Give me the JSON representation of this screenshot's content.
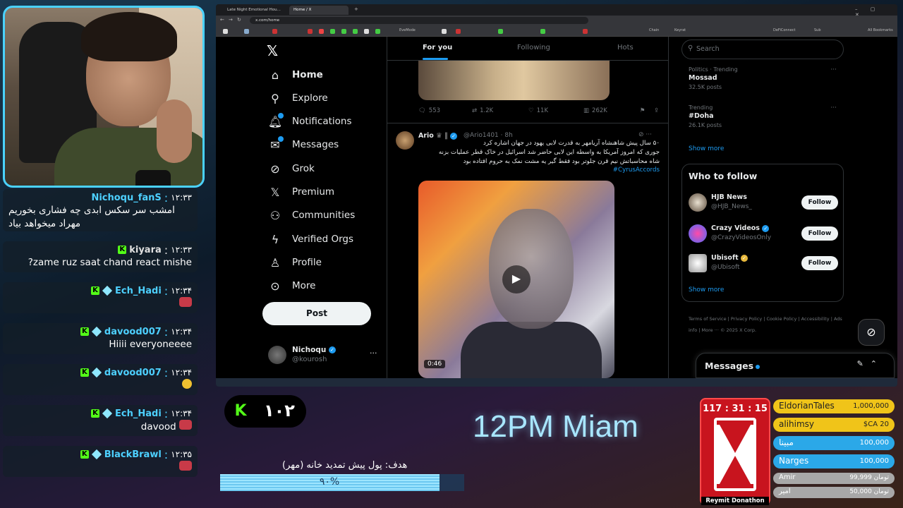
{
  "webcam": {
    "label": "streamer-webcam"
  },
  "chat": {
    "messages": [
      {
        "time": "۱۲:۳۳",
        "user": "Nichoqu_fanS",
        "user_color": "#4dd0ff",
        "text": "امشب سر سکس ابدی چه فشاری بخوریم مهراد میخواهد بیاد"
      },
      {
        "time": "۱۲:۳۳",
        "user": "kiyara",
        "user_color": "#e0e0e0",
        "text": "?zame ruz saat chand react mishe"
      },
      {
        "time": "۱۲:۳۴",
        "user": "Ech_Hadi",
        "user_color": "#4dd0ff",
        "text": ""
      },
      {
        "time": "۱۲:۳۴",
        "user": "davood007",
        "user_color": "#4dd0ff",
        "text": "Hiiii everyoneeee"
      },
      {
        "time": "۱۲:۳۴",
        "user": "davood007",
        "user_color": "#4dd0ff",
        "text": ""
      },
      {
        "time": "۱۲:۳۴",
        "user": "Ech_Hadi",
        "user_color": "#4dd0ff",
        "text": "davood"
      },
      {
        "time": "۱۲:۳۵",
        "user": "BlackBrawl",
        "user_color": "#4dd0ff",
        "text": ""
      }
    ]
  },
  "browser": {
    "tabs": [
      "Late Night Emotional Hou...",
      "Home / X"
    ],
    "url": "x.com/home",
    "bookmark_labels": [
      "EveMode",
      "Chain",
      "Keyrat",
      "DeFiConnect",
      "Sub",
      "All Bookmarks"
    ]
  },
  "x": {
    "nav": [
      {
        "label": "Home",
        "icon": "home-icon"
      },
      {
        "label": "Explore",
        "icon": "search-icon"
      },
      {
        "label": "Notifications",
        "icon": "bell-icon"
      },
      {
        "label": "Messages",
        "icon": "envelope-icon"
      },
      {
        "label": "Grok",
        "icon": "grok-icon"
      },
      {
        "label": "Premium",
        "icon": "x-icon"
      },
      {
        "label": "Communities",
        "icon": "people-icon"
      },
      {
        "label": "Verified Orgs",
        "icon": "lightning-icon"
      },
      {
        "label": "Profile",
        "icon": "person-icon"
      },
      {
        "label": "More",
        "icon": "more-circle-icon"
      }
    ],
    "post_label": "Post",
    "profile": {
      "name": "Nichoqu",
      "handle": "@kourosh"
    },
    "feed_tabs": [
      "For you",
      "Following",
      "Hots"
    ],
    "prev_actions": {
      "replies": "553",
      "reposts": "1.2K",
      "likes": "11K",
      "views": "262K"
    },
    "tweet": {
      "name": "Ario",
      "handle": "@Ario1401 · 8h",
      "lines": [
        "۵۰ سال پیش شاهنشاه آریامهر به قدرت لابی یهود در جهان اشاره کرد",
        "جوری که امروز آمریکا به واسطه این لابی حاضر شد اسرائیل در خاک قطر عملیات بزنه",
        "شاه محاسباتش نیم قرن جلوتر بود فقط گیر یه مشت نمک به حروم افتاده بود"
      ],
      "hashtag": "#CyrusAccords",
      "duration": "0:46"
    },
    "search_placeholder": "Search",
    "trends": [
      {
        "category": "Politics · Trending",
        "name": "Mossad",
        "count": "32.5K posts"
      },
      {
        "category": "Trending",
        "name": "#Doha",
        "count": "26.1K posts"
      }
    ],
    "show_more": "Show more",
    "who_to_follow": {
      "title": "Who to follow",
      "accounts": [
        {
          "name": "HJB News",
          "handle": "@HJB_News_",
          "verified": "none"
        },
        {
          "name": "Crazy Videos",
          "handle": "@CrazyVideosOnly",
          "verified": "blue"
        },
        {
          "name": "Ubisoft",
          "handle": "@Ubisoft",
          "verified": "gold"
        }
      ],
      "follow_label": "Follow",
      "show_more": "Show more"
    },
    "footer": "Terms of Service  |  Privacy Policy  |  Cookie Policy  |  Accessibility  |  Ads info  |  More ···  © 2025 X Corp.",
    "messages_drawer": "Messages"
  },
  "overlay": {
    "kick_count": "۱۰۲",
    "stream_title": "12PM Miam",
    "goal_label": "هدف: پول پیش تمدید خانه (مهر)",
    "goal_percent_text": "۹۰%",
    "goal_progress": 0.9,
    "timer": "117 : 31 : 15",
    "donation_label": "Reymit Donathon",
    "leaderboard": [
      {
        "name": "EldorianTales",
        "amount": "1,000,000",
        "color": "#f0c419",
        "style": "dark"
      },
      {
        "name": "alihimsy",
        "amount": "$CA 20",
        "color": "#f0c419",
        "style": "dark"
      },
      {
        "name": "مبینا",
        "amount": "100,000",
        "color": "#2ba8e8",
        "style": "light"
      },
      {
        "name": "Narges",
        "amount": "100,000",
        "color": "#2ba8e8",
        "style": "light"
      },
      {
        "name": "Amir",
        "amount": "99,999 تومان",
        "color": "#a8a8a8",
        "style": "small"
      },
      {
        "name": "امیر",
        "amount": "50,000 تومان",
        "color": "#a8a8a8",
        "style": "small"
      }
    ]
  }
}
